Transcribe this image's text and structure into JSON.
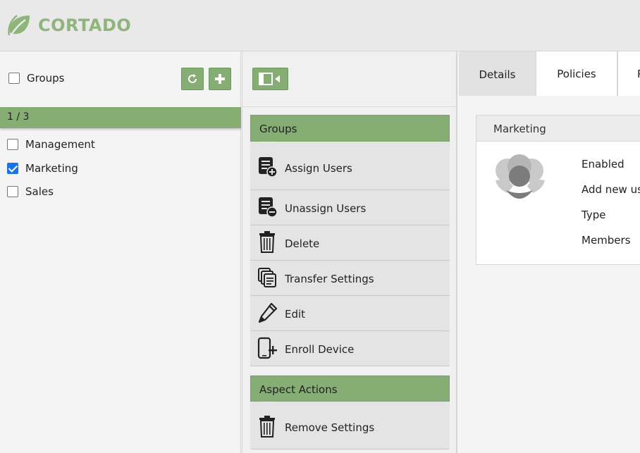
{
  "header": {
    "logo_text": "CORTADO",
    "brand_color": "#86ad74"
  },
  "left_pane": {
    "select_all_label": "Groups",
    "refresh_icon": "refresh-icon",
    "add_icon": "plus-icon",
    "count": "1 / 3",
    "items": [
      {
        "label": "Management",
        "checked": false
      },
      {
        "label": "Marketing",
        "checked": true
      },
      {
        "label": "Sales",
        "checked": false
      }
    ]
  },
  "middle_pane": {
    "collapse_icon": "sidebar-collapse-icon",
    "sections": [
      {
        "title": "Groups",
        "actions": [
          {
            "label": "Assign Users",
            "icon": "assign-users-icon"
          },
          {
            "label": "Unassign Users",
            "icon": "unassign-users-icon"
          },
          {
            "label": "Delete",
            "icon": "trash-icon"
          },
          {
            "label": "Transfer Settings",
            "icon": "transfer-settings-icon"
          },
          {
            "label": "Edit",
            "icon": "pencil-icon"
          },
          {
            "label": "Enroll Device",
            "icon": "enroll-device-icon"
          }
        ]
      },
      {
        "title": "Aspect Actions",
        "actions": [
          {
            "label": "Remove Settings",
            "icon": "trash-icon"
          }
        ]
      }
    ]
  },
  "right_pane": {
    "tabs": [
      {
        "label": "Details",
        "active": true
      },
      {
        "label": "Policies",
        "active": false
      },
      {
        "label": "P",
        "active": false
      }
    ],
    "card": {
      "title": "Marketing",
      "avatar_icon": "group-avatar-icon",
      "properties": [
        "Enabled",
        "Add new us",
        "Type",
        "Members"
      ]
    }
  }
}
